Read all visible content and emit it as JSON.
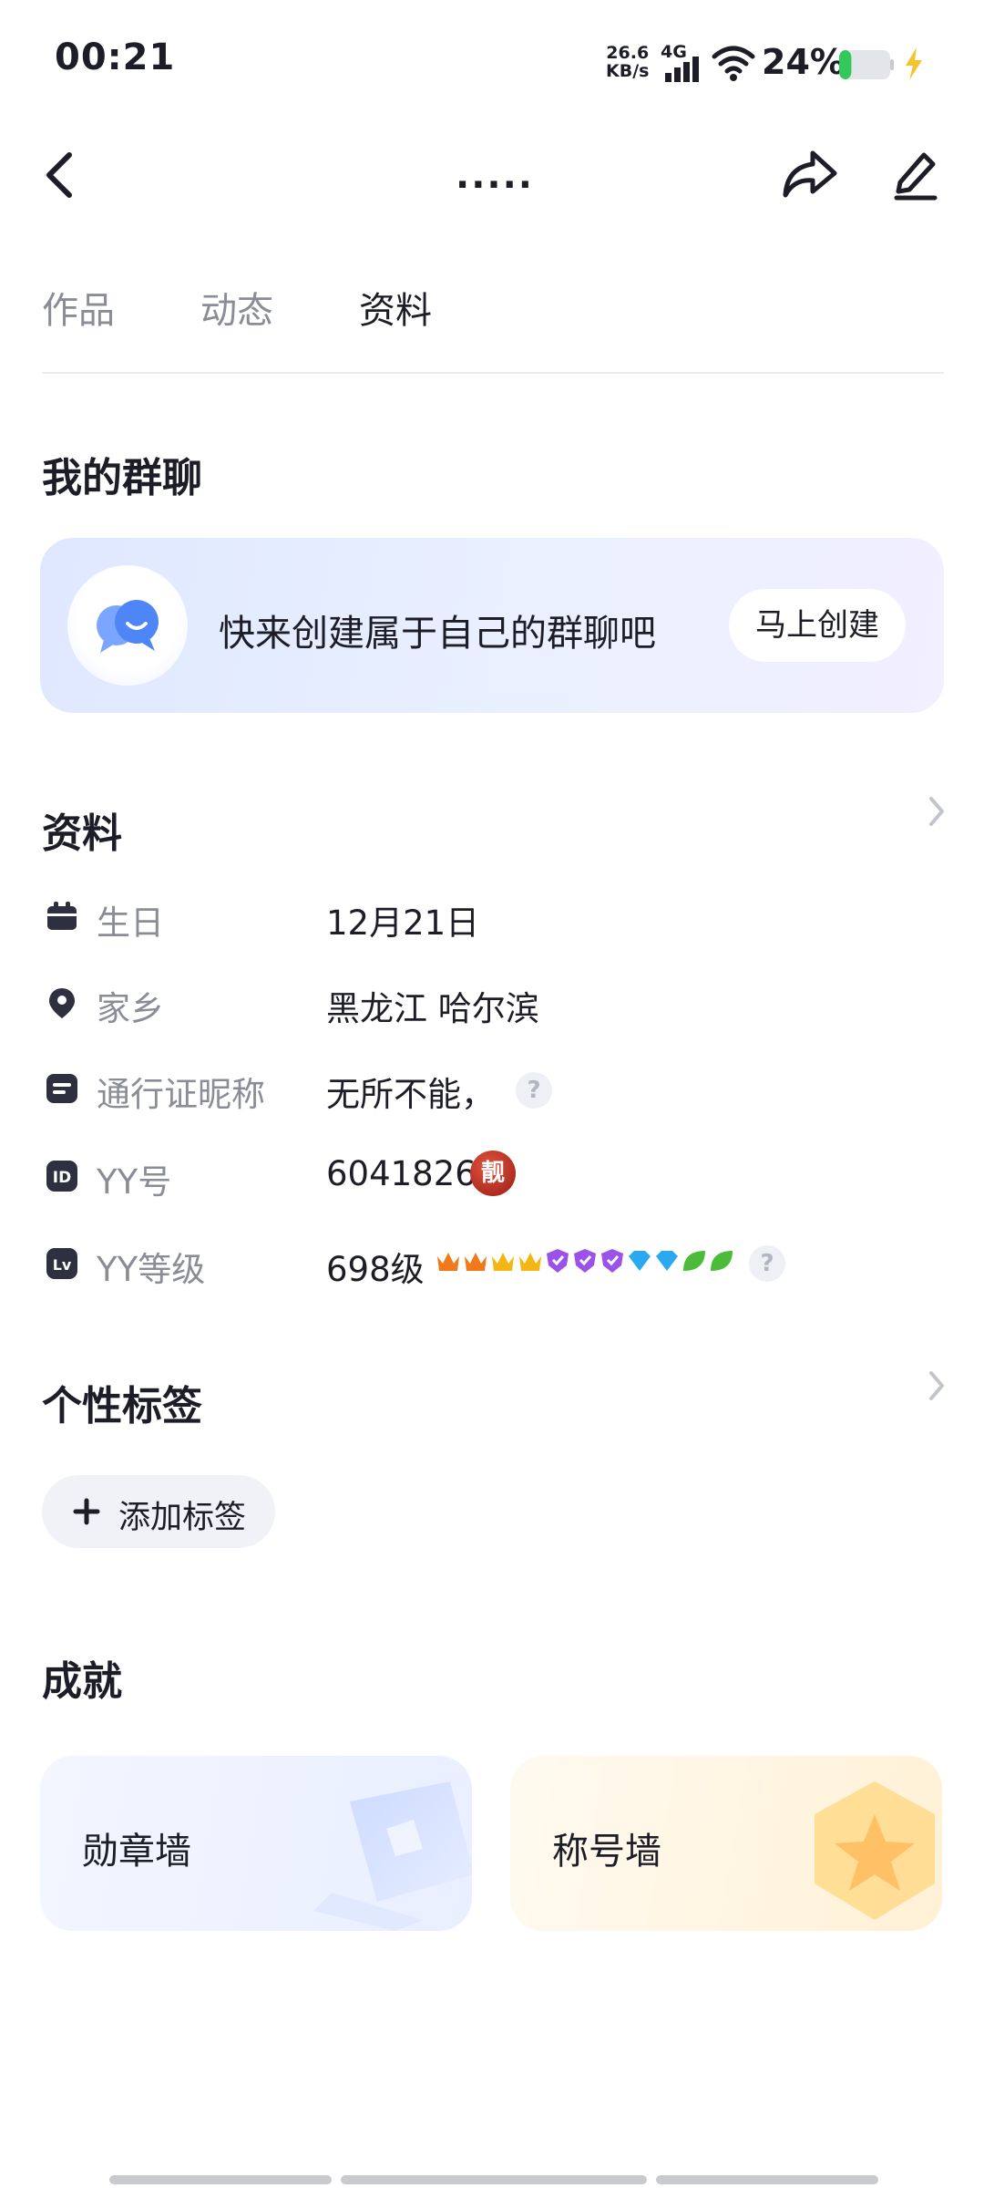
{
  "status_bar": {
    "time": "00:21",
    "speed_value": "26.6",
    "speed_unit": "KB/s",
    "network": "4G",
    "battery_percent": "24%",
    "battery_level": 0.24,
    "icons": [
      "signal-icon",
      "wifi-icon",
      "battery-icon",
      "charging-icon"
    ]
  },
  "nav": {
    "title": ".....",
    "icons": [
      "back-icon",
      "share-icon",
      "edit-icon"
    ]
  },
  "tabs": [
    {
      "label": "作品",
      "active": false
    },
    {
      "label": "动态",
      "active": false
    },
    {
      "label": "资料",
      "active": true
    }
  ],
  "group_chat": {
    "section_title": "我的群聊",
    "prompt": "快来创建属于自己的群聊吧",
    "button_label": "马上创建"
  },
  "profile": {
    "section_title": "资料",
    "rows": [
      {
        "icon": "calendar-icon",
        "label": "生日",
        "value": "12月21日"
      },
      {
        "icon": "location-icon",
        "label": "家乡",
        "value": "黑龙江 哈尔滨"
      },
      {
        "icon": "id-card-icon",
        "label": "通行证昵称",
        "value": "无所不能，"
      },
      {
        "icon": "id-icon",
        "label": "YY号",
        "value": "6041826",
        "badge": "靓"
      },
      {
        "icon": "level-icon",
        "label": "YY等级",
        "value": "698级"
      }
    ],
    "help_mark": "?",
    "level_badges": [
      "crown-orange",
      "crown-orange",
      "crown-gold",
      "crown-gold",
      "shield-purple",
      "shield-purple",
      "shield-purple",
      "diamond-blue",
      "diamond-blue",
      "leaf-green",
      "leaf-green"
    ]
  },
  "tags": {
    "section_title": "个性标签",
    "add_label": "添加标签"
  },
  "achievements": {
    "section_title": "成就",
    "cards": [
      {
        "label": "勋章墙",
        "theme": "#e9efff"
      },
      {
        "label": "称号墙",
        "theme": "#fff1d6"
      }
    ]
  },
  "colors": {
    "text_primary": "#1c1d26",
    "text_secondary": "#8a8d96",
    "accent_blue": "#5b8cff",
    "battery_green": "#34c759",
    "charge_yellow": "#f4c430"
  }
}
